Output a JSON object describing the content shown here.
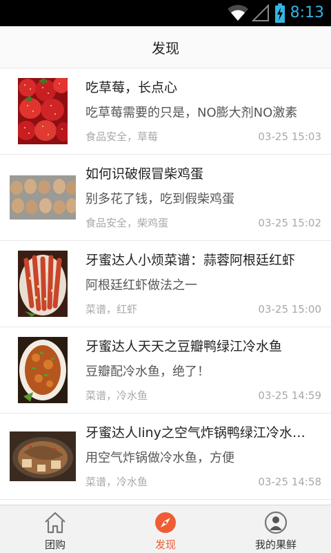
{
  "status_bar": {
    "time": "8:13",
    "icons": [
      "wifi-icon",
      "signal-icon",
      "battery-charging-icon"
    ],
    "accent_color": "#33b5e5"
  },
  "header": {
    "title": "发现"
  },
  "articles": [
    {
      "title": "吃草莓，长点心",
      "desc": "吃草莓需要的只是，NO膨大剂NO激素",
      "tags": "食品安全，草莓",
      "time": "03-25 15:03",
      "thumbnail": "strawberries"
    },
    {
      "title": "如何识破假冒柴鸡蛋",
      "desc": "别多花了钱，吃到假柴鸡蛋",
      "tags": "食品安全，柴鸡蛋",
      "time": "03-25 15:02",
      "thumbnail": "eggs"
    },
    {
      "title": "牙蜜达人小烦菜谱：蒜蓉阿根廷红虾",
      "desc": "阿根廷红虾做法之一",
      "tags": "菜谱，红虾",
      "time": "03-25 15:00",
      "thumbnail": "red-shrimp-dish"
    },
    {
      "title": "牙蜜达人天天之豆瓣鸭绿江冷水鱼",
      "desc": "豆瓣配冷水鱼，绝了！",
      "tags": "菜谱，冷水鱼",
      "time": "03-25 14:59",
      "thumbnail": "fish-dish"
    },
    {
      "title": "牙蜜达人liny之空气炸锅鸭绿江冷水…",
      "desc": "用空气炸锅做冷水鱼，方便",
      "tags": "菜谱，冷水鱼",
      "time": "03-25 14:58",
      "thumbnail": "air-fried-fish"
    }
  ],
  "tabs": [
    {
      "label": "团购",
      "icon": "home-icon",
      "active": false
    },
    {
      "label": "发现",
      "icon": "compass-icon",
      "active": true
    },
    {
      "label": "我的果鲜",
      "icon": "user-icon",
      "active": false
    }
  ],
  "colors": {
    "active_tab": "#ee5d33",
    "text": "#222222",
    "meta": "#a8a8a8"
  }
}
